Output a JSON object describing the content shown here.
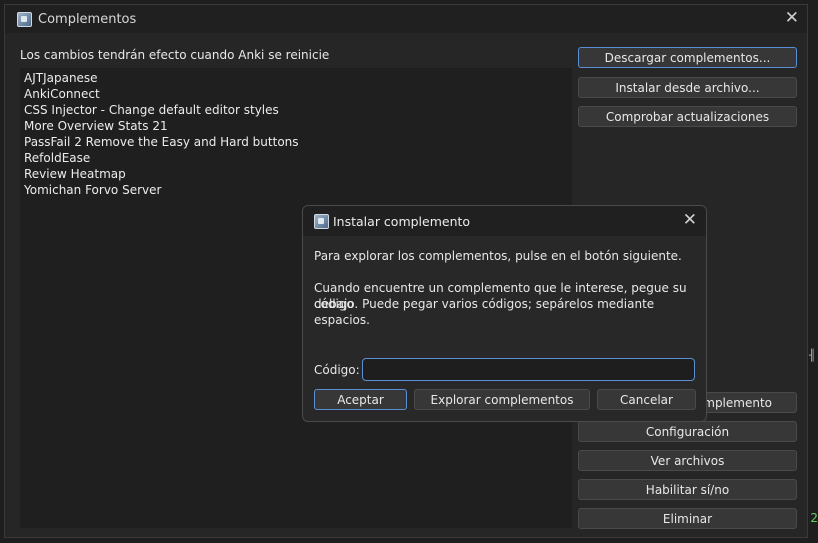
{
  "window": {
    "title": "Complementos",
    "app_icon": "anki-icon",
    "close_icon": "close-icon"
  },
  "note": "Los cambios tendrán efecto cuando Anki se reinicie",
  "addons": [
    "AJTJapanese",
    "AnkiConnect",
    "CSS Injector - Change default editor styles",
    "More Overview Stats 21",
    "PassFail 2 Remove the Easy and Hard buttons",
    "RefoldEase",
    "Review Heatmap",
    "Yomichan Forvo Server"
  ],
  "side_buttons": {
    "download": "Descargar complementos...",
    "install_file": "Instalar desde archivo...",
    "check_updates": "Comprobar actualizaciones",
    "partial": "mplemento",
    "config": "Configuración",
    "view_files": "Ver archivos",
    "toggle": "Habilitar sí/no",
    "delete": "Eliminar"
  },
  "dialog": {
    "title": "Instalar complemento",
    "line1": "Para explorar los complementos, pulse en el botón siguiente.",
    "line2": "Cuando encuentre un complemento que le interese, pegue su código",
    "line3": "debajo. Puede pegar varios códigos; sepárelos mediante espacios.",
    "code_label": "Código:",
    "code_value": "",
    "ok": "Aceptar",
    "browse": "Explorar complementos",
    "cancel": "Cancelar"
  },
  "edge_number": "2",
  "colors": {
    "accent": "#5a8fd6",
    "background": "#262626",
    "edge_number": "#5fd35f"
  }
}
